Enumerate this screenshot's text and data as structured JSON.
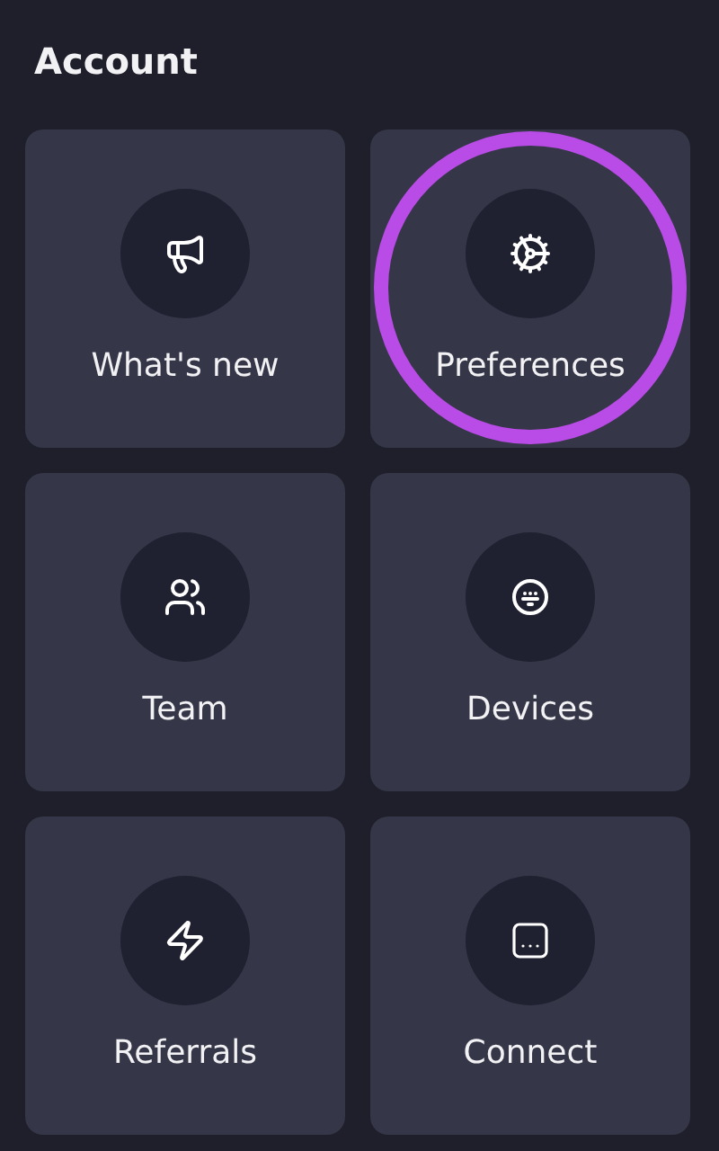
{
  "title": "Account",
  "tiles": [
    {
      "label": "What's new",
      "highlighted": false
    },
    {
      "label": "Preferences",
      "highlighted": true
    },
    {
      "label": "Team",
      "highlighted": false
    },
    {
      "label": "Devices",
      "highlighted": false
    },
    {
      "label": "Referrals",
      "highlighted": false
    },
    {
      "label": "Connect",
      "highlighted": false
    }
  ]
}
